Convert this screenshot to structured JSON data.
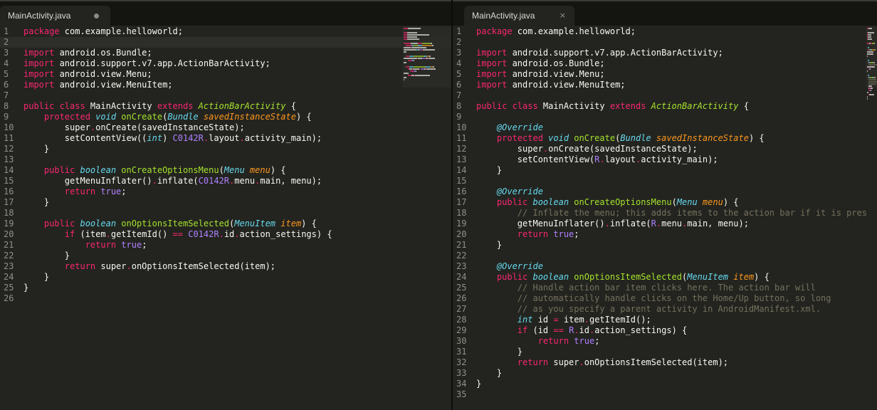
{
  "left_pane": {
    "tab": {
      "title": "MainActivity.java",
      "state_icon": "unsaved-dot-icon"
    },
    "current_line": 2,
    "lines": [
      {
        "n": "1",
        "segs": [
          [
            "package ",
            "kw"
          ],
          [
            "com.example.helloworld",
            ""
          ],
          [
            ";",
            ""
          ]
        ]
      },
      {
        "n": "2",
        "segs": []
      },
      {
        "n": "3",
        "segs": [
          [
            "import ",
            "kw"
          ],
          [
            "android.os.Bundle",
            ""
          ],
          [
            ";",
            ""
          ]
        ]
      },
      {
        "n": "4",
        "segs": [
          [
            "import ",
            "kw"
          ],
          [
            "android.support.v7.app.ActionBarActivity",
            ""
          ],
          [
            ";",
            ""
          ]
        ]
      },
      {
        "n": "5",
        "segs": [
          [
            "import ",
            "kw"
          ],
          [
            "android.view.Menu",
            ""
          ],
          [
            ";",
            ""
          ]
        ]
      },
      {
        "n": "6",
        "segs": [
          [
            "import ",
            "kw"
          ],
          [
            "android.view.MenuItem",
            ""
          ],
          [
            ";",
            ""
          ]
        ]
      },
      {
        "n": "7",
        "segs": []
      },
      {
        "n": "8",
        "segs": [
          [
            "public class ",
            "kw"
          ],
          [
            "MainActivity ",
            ""
          ],
          [
            "extends ",
            "kw"
          ],
          [
            "ActionBarActivity",
            "cls"
          ],
          [
            " {",
            ""
          ]
        ]
      },
      {
        "n": "9",
        "segs": [
          [
            "    ",
            ""
          ],
          [
            "protected ",
            "kw"
          ],
          [
            "void ",
            "typ"
          ],
          [
            "onCreate",
            "fn"
          ],
          [
            "(",
            ""
          ],
          [
            "Bundle ",
            "typ"
          ],
          [
            "savedInstanceState",
            "par"
          ],
          [
            ") {",
            ""
          ]
        ]
      },
      {
        "n": "10",
        "segs": [
          [
            "        super",
            ""
          ],
          [
            ".",
            "kw"
          ],
          [
            "onCreate(savedInstanceState);",
            ""
          ]
        ]
      },
      {
        "n": "11",
        "segs": [
          [
            "        setContentView((",
            ""
          ],
          [
            "int",
            "typ"
          ],
          [
            ") ",
            ""
          ],
          [
            "C0142R",
            "con"
          ],
          [
            ".",
            "kw"
          ],
          [
            "layout",
            ""
          ],
          [
            ".",
            "kw"
          ],
          [
            "activity_main);",
            ""
          ]
        ]
      },
      {
        "n": "12",
        "segs": [
          [
            "    }",
            ""
          ]
        ]
      },
      {
        "n": "13",
        "segs": []
      },
      {
        "n": "14",
        "segs": [
          [
            "    ",
            ""
          ],
          [
            "public ",
            "kw"
          ],
          [
            "boolean ",
            "typ"
          ],
          [
            "onCreateOptionsMenu",
            "fn"
          ],
          [
            "(",
            ""
          ],
          [
            "Menu ",
            "typ"
          ],
          [
            "menu",
            "par"
          ],
          [
            ") {",
            ""
          ]
        ]
      },
      {
        "n": "15",
        "segs": [
          [
            "        getMenuInflater()",
            ""
          ],
          [
            ".",
            "kw"
          ],
          [
            "inflate(",
            ""
          ],
          [
            "C0142R",
            "con"
          ],
          [
            ".",
            "kw"
          ],
          [
            "menu",
            ""
          ],
          [
            ".",
            "kw"
          ],
          [
            "main, menu);",
            ""
          ]
        ]
      },
      {
        "n": "16",
        "segs": [
          [
            "        ",
            ""
          ],
          [
            "return ",
            "kw"
          ],
          [
            "true",
            "con"
          ],
          [
            ";",
            ""
          ]
        ]
      },
      {
        "n": "17",
        "segs": [
          [
            "    }",
            ""
          ]
        ]
      },
      {
        "n": "18",
        "segs": []
      },
      {
        "n": "19",
        "segs": [
          [
            "    ",
            ""
          ],
          [
            "public ",
            "kw"
          ],
          [
            "boolean ",
            "typ"
          ],
          [
            "onOptionsItemSelected",
            "fn"
          ],
          [
            "(",
            ""
          ],
          [
            "MenuItem ",
            "typ"
          ],
          [
            "item",
            "par"
          ],
          [
            ") {",
            ""
          ]
        ]
      },
      {
        "n": "20",
        "segs": [
          [
            "        ",
            ""
          ],
          [
            "if ",
            "kw"
          ],
          [
            "(item",
            ""
          ],
          [
            ".",
            "kw"
          ],
          [
            "getItemId() ",
            ""
          ],
          [
            "==",
            "kw"
          ],
          [
            " ",
            ""
          ],
          [
            "C0142R",
            "con"
          ],
          [
            ".",
            "kw"
          ],
          [
            "id",
            ""
          ],
          [
            ".",
            "kw"
          ],
          [
            "action_settings) {",
            ""
          ]
        ]
      },
      {
        "n": "21",
        "segs": [
          [
            "            ",
            ""
          ],
          [
            "return ",
            "kw"
          ],
          [
            "true",
            "con"
          ],
          [
            ";",
            ""
          ]
        ]
      },
      {
        "n": "22",
        "segs": [
          [
            "        }",
            ""
          ]
        ]
      },
      {
        "n": "23",
        "segs": [
          [
            "        ",
            ""
          ],
          [
            "return ",
            "kw"
          ],
          [
            "super",
            ""
          ],
          [
            ".",
            "kw"
          ],
          [
            "onOptionsItemSelected(item);",
            ""
          ]
        ]
      },
      {
        "n": "24",
        "segs": [
          [
            "    }",
            ""
          ]
        ]
      },
      {
        "n": "25",
        "segs": [
          [
            "}",
            ""
          ]
        ]
      },
      {
        "n": "26",
        "segs": []
      }
    ]
  },
  "right_pane": {
    "tab": {
      "title": "MainActivity.java",
      "state_icon": "close-icon",
      "close_glyph": "×"
    },
    "current_line": 0,
    "lines": [
      {
        "n": "1",
        "segs": [
          [
            "package ",
            "kw"
          ],
          [
            "com.example.helloworld",
            ""
          ],
          [
            ";",
            ""
          ]
        ]
      },
      {
        "n": "2",
        "segs": []
      },
      {
        "n": "3",
        "segs": [
          [
            "import ",
            "kw"
          ],
          [
            "android.support.v7.app.ActionBarActivity",
            ""
          ],
          [
            ";",
            ""
          ]
        ]
      },
      {
        "n": "4",
        "segs": [
          [
            "import ",
            "kw"
          ],
          [
            "android.os.Bundle",
            ""
          ],
          [
            ";",
            ""
          ]
        ]
      },
      {
        "n": "5",
        "segs": [
          [
            "import ",
            "kw"
          ],
          [
            "android.view.Menu",
            ""
          ],
          [
            ";",
            ""
          ]
        ]
      },
      {
        "n": "6",
        "segs": [
          [
            "import ",
            "kw"
          ],
          [
            "android.view.MenuItem",
            ""
          ],
          [
            ";",
            ""
          ]
        ]
      },
      {
        "n": "7",
        "segs": []
      },
      {
        "n": "8",
        "segs": [
          [
            "public class ",
            "kw"
          ],
          [
            "MainActivity ",
            ""
          ],
          [
            "extends ",
            "kw"
          ],
          [
            "ActionBarActivity",
            "cls"
          ],
          [
            " {",
            ""
          ]
        ]
      },
      {
        "n": "9",
        "segs": []
      },
      {
        "n": "10",
        "segs": [
          [
            "    ",
            ""
          ],
          [
            "@Override",
            "an"
          ]
        ]
      },
      {
        "n": "11",
        "segs": [
          [
            "    ",
            ""
          ],
          [
            "protected ",
            "kw"
          ],
          [
            "void ",
            "typ"
          ],
          [
            "onCreate",
            "fn"
          ],
          [
            "(",
            ""
          ],
          [
            "Bundle ",
            "typ"
          ],
          [
            "savedInstanceState",
            "par"
          ],
          [
            ") {",
            ""
          ]
        ]
      },
      {
        "n": "12",
        "segs": [
          [
            "        super",
            ""
          ],
          [
            ".",
            "kw"
          ],
          [
            "onCreate(savedInstanceState);",
            ""
          ]
        ]
      },
      {
        "n": "13",
        "segs": [
          [
            "        setContentView(",
            ""
          ],
          [
            "R",
            "con"
          ],
          [
            ".",
            "kw"
          ],
          [
            "layout",
            ""
          ],
          [
            ".",
            "kw"
          ],
          [
            "activity_main);",
            ""
          ]
        ]
      },
      {
        "n": "14",
        "segs": [
          [
            "    }",
            ""
          ]
        ]
      },
      {
        "n": "15",
        "segs": []
      },
      {
        "n": "16",
        "segs": [
          [
            "    ",
            ""
          ],
          [
            "@Override",
            "an"
          ]
        ]
      },
      {
        "n": "17",
        "segs": [
          [
            "    ",
            ""
          ],
          [
            "public ",
            "kw"
          ],
          [
            "boolean ",
            "typ"
          ],
          [
            "onCreateOptionsMenu",
            "fn"
          ],
          [
            "(",
            ""
          ],
          [
            "Menu ",
            "typ"
          ],
          [
            "menu",
            "par"
          ],
          [
            ") {",
            ""
          ]
        ]
      },
      {
        "n": "18",
        "segs": [
          [
            "        ",
            ""
          ],
          [
            "// Inflate the menu; this adds items to the action bar if it is pres",
            "cm"
          ]
        ]
      },
      {
        "n": "19",
        "segs": [
          [
            "        getMenuInflater()",
            ""
          ],
          [
            ".",
            "kw"
          ],
          [
            "inflate(",
            ""
          ],
          [
            "R",
            "con"
          ],
          [
            ".",
            "kw"
          ],
          [
            "menu",
            ""
          ],
          [
            ".",
            "kw"
          ],
          [
            "main, menu);",
            ""
          ]
        ]
      },
      {
        "n": "20",
        "segs": [
          [
            "        ",
            ""
          ],
          [
            "return ",
            "kw"
          ],
          [
            "true",
            "con"
          ],
          [
            ";",
            ""
          ]
        ]
      },
      {
        "n": "21",
        "segs": [
          [
            "    }",
            ""
          ]
        ]
      },
      {
        "n": "22",
        "segs": []
      },
      {
        "n": "23",
        "segs": [
          [
            "    ",
            ""
          ],
          [
            "@Override",
            "an"
          ]
        ]
      },
      {
        "n": "24",
        "segs": [
          [
            "    ",
            ""
          ],
          [
            "public ",
            "kw"
          ],
          [
            "boolean ",
            "typ"
          ],
          [
            "onOptionsItemSelected",
            "fn"
          ],
          [
            "(",
            ""
          ],
          [
            "MenuItem ",
            "typ"
          ],
          [
            "item",
            "par"
          ],
          [
            ") {",
            ""
          ]
        ]
      },
      {
        "n": "25",
        "segs": [
          [
            "        ",
            ""
          ],
          [
            "// Handle action bar item clicks here. The action bar will",
            "cm"
          ]
        ]
      },
      {
        "n": "26",
        "segs": [
          [
            "        ",
            ""
          ],
          [
            "// automatically handle clicks on the Home/Up button, so long",
            "cm"
          ]
        ]
      },
      {
        "n": "27",
        "segs": [
          [
            "        ",
            ""
          ],
          [
            "// as you specify a parent activity in AndroidManifest.xml.",
            "cm"
          ]
        ]
      },
      {
        "n": "28",
        "segs": [
          [
            "        ",
            ""
          ],
          [
            "int ",
            "typ"
          ],
          [
            "id ",
            ""
          ],
          [
            "=",
            "kw"
          ],
          [
            " item",
            ""
          ],
          [
            ".",
            "kw"
          ],
          [
            "getItemId();",
            ""
          ]
        ]
      },
      {
        "n": "29",
        "segs": [
          [
            "        ",
            ""
          ],
          [
            "if ",
            "kw"
          ],
          [
            "(id ",
            ""
          ],
          [
            "==",
            "kw"
          ],
          [
            " ",
            ""
          ],
          [
            "R",
            "con"
          ],
          [
            ".",
            "kw"
          ],
          [
            "id",
            ""
          ],
          [
            ".",
            "kw"
          ],
          [
            "action_settings) {",
            ""
          ]
        ]
      },
      {
        "n": "30",
        "segs": [
          [
            "            ",
            ""
          ],
          [
            "return ",
            "kw"
          ],
          [
            "true",
            "con"
          ],
          [
            ";",
            ""
          ]
        ]
      },
      {
        "n": "31",
        "segs": [
          [
            "        }",
            ""
          ]
        ]
      },
      {
        "n": "32",
        "segs": [
          [
            "        ",
            ""
          ],
          [
            "return ",
            "kw"
          ],
          [
            "super",
            ""
          ],
          [
            ".",
            "kw"
          ],
          [
            "onOptionsItemSelected(item);",
            ""
          ]
        ]
      },
      {
        "n": "33",
        "segs": [
          [
            "    }",
            ""
          ]
        ]
      },
      {
        "n": "34",
        "segs": [
          [
            "}",
            ""
          ]
        ]
      },
      {
        "n": "35",
        "segs": []
      }
    ]
  },
  "theme": {
    "background": "#23241f",
    "keyword": "#f92672",
    "type": "#66d9ef",
    "function": "#a6e22e",
    "parameter": "#fd971f",
    "constant": "#ae81ff",
    "comment": "#75715e",
    "text": "#f8f8f2",
    "line_number": "#90908a"
  }
}
